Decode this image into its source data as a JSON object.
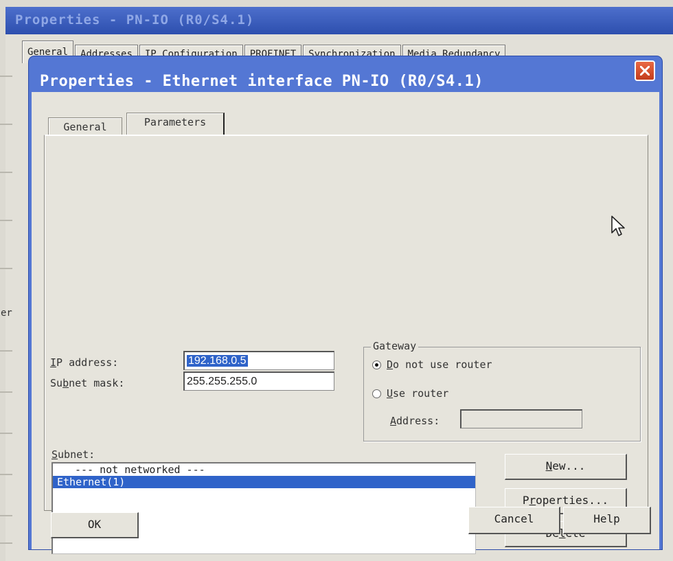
{
  "parent_window": {
    "title": "Properties - PN-IO (R0/S4.1)",
    "tabs": [
      "General",
      "Addresses",
      "IP Configuration",
      "PROFINET",
      "Synchronization",
      "Media Redundancy"
    ],
    "left_glyph": "er"
  },
  "dialog": {
    "title": "Properties - Ethernet interface  PN-IO (R0/S4.1)",
    "tabs": [
      "General",
      "Parameters"
    ],
    "active_tab": "Parameters",
    "ip_address": {
      "label_u": "I",
      "label_rest": "P address:",
      "value": "192.168.0.5"
    },
    "subnet_mask": {
      "label_pre": "Su",
      "label_u": "b",
      "label_rest": "net mask:",
      "value": "255.255.255.0"
    },
    "gateway": {
      "title": "Gateway",
      "option1": {
        "u": "D",
        "rest": "o not use router",
        "checked": true
      },
      "option2": {
        "u": "U",
        "rest": "se router",
        "checked": false
      },
      "address_label": {
        "u": "A",
        "rest": "ddress:"
      },
      "address_value": ""
    },
    "subnet": {
      "label_u": "S",
      "label_rest": "ubnet:",
      "items": [
        "--- not networked ---",
        "Ethernet(1)"
      ],
      "selected_index": 1
    },
    "buttons": {
      "new": {
        "u": "N",
        "rest": "ew..."
      },
      "properties": {
        "pre": "P",
        "u": "r",
        "rest": "operties..."
      },
      "delete": {
        "pre": "De",
        "u": "l",
        "rest": "ete"
      },
      "ok": "OK",
      "cancel": "Cancel",
      "help": "Help"
    }
  },
  "colors": {
    "titlebar": "#5477d4",
    "selection": "#2f63c9",
    "close_button": "#d64f2c",
    "dialog_bg": "#e6e4dc"
  }
}
